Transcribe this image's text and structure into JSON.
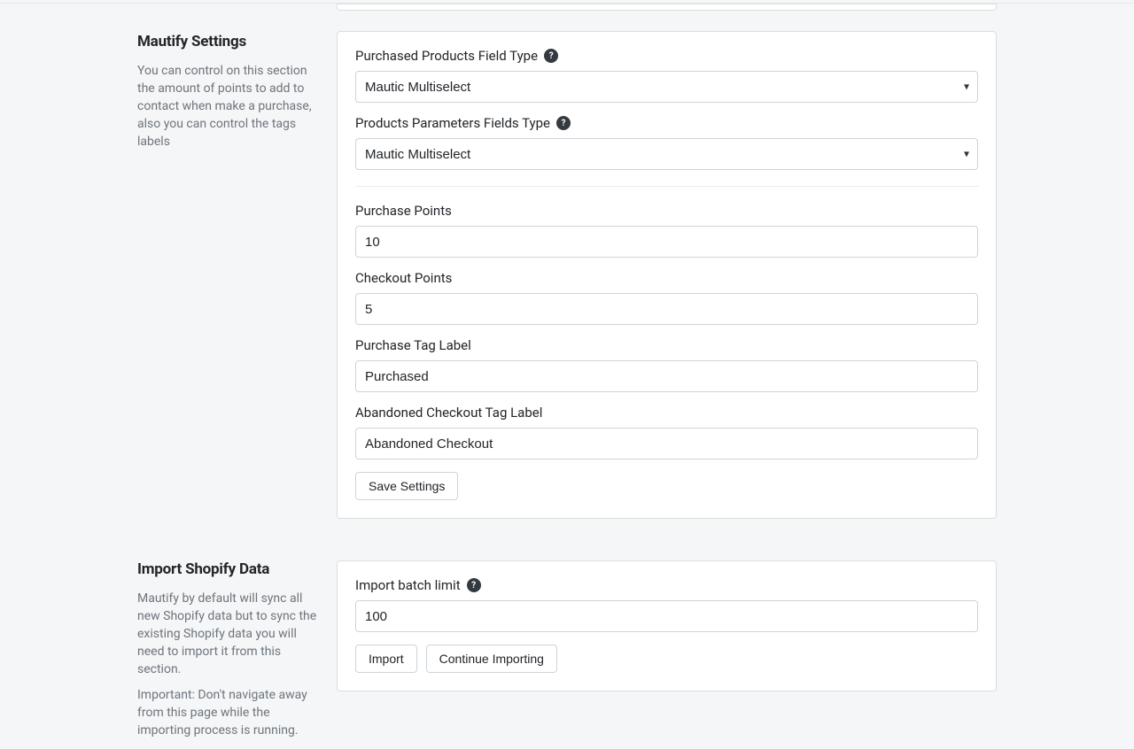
{
  "mautify": {
    "title": "Mautify Settings",
    "desc": "You can control on this section the amount of points to add to contact when make a purchase, also you can control the tags labels",
    "labels": {
      "purchased_products_field_type": "Purchased Products Field Type",
      "products_parameters_fields_type": "Products Parameters Fields Type",
      "purchase_points": "Purchase Points",
      "checkout_points": "Checkout Points",
      "purchase_tag_label": "Purchase Tag Label",
      "abandoned_checkout_tag_label": "Abandoned Checkout Tag Label",
      "save_settings": "Save Settings"
    },
    "values": {
      "purchased_products_field_type": "Mautic Multiselect",
      "products_parameters_fields_type": "Mautic Multiselect",
      "purchase_points": "10",
      "checkout_points": "5",
      "purchase_tag_label": "Purchased",
      "abandoned_checkout_tag_label": "Abandoned Checkout"
    }
  },
  "import": {
    "title": "Import Shopify Data",
    "desc1": "Mautify by default will sync all new Shopify data but to sync the existing Shopify data you will need to import it from this section.",
    "desc2": "Important: Don't navigate away from this page while the importing process is running.",
    "labels": {
      "import_batch_limit": "Import batch limit",
      "import": "Import",
      "continue_importing": "Continue Importing"
    },
    "values": {
      "import_batch_limit": "100"
    }
  },
  "help_glyph": "?"
}
